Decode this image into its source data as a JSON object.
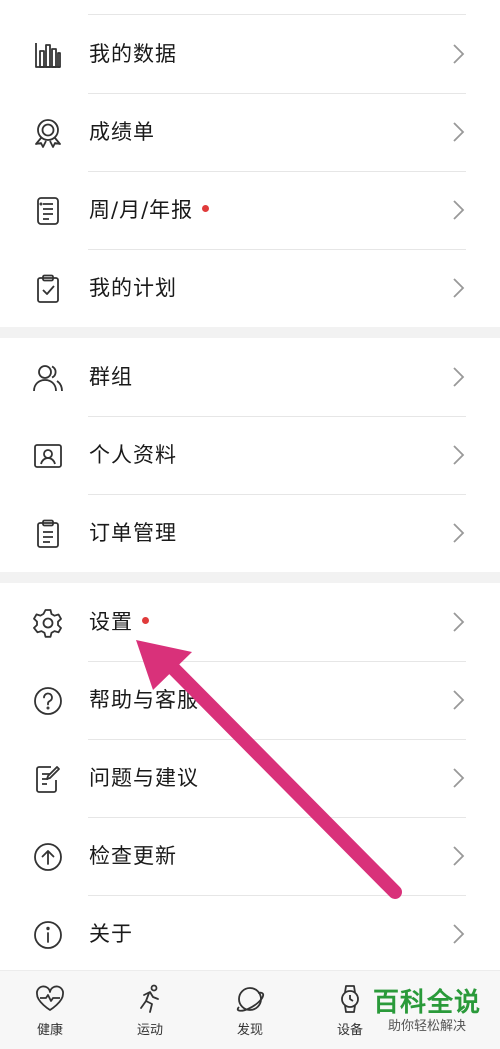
{
  "menu": {
    "section1": [
      {
        "id": "my-data",
        "label": "我的数据",
        "icon": "bar-chart-icon",
        "dot": false
      },
      {
        "id": "report-card",
        "label": "成绩单",
        "icon": "medal-icon",
        "dot": false
      },
      {
        "id": "reports",
        "label": "周/月/年报",
        "icon": "document-list-icon",
        "dot": true
      },
      {
        "id": "my-plan",
        "label": "我的计划",
        "icon": "clipboard-check-icon",
        "dot": false
      }
    ],
    "section2": [
      {
        "id": "groups",
        "label": "群组",
        "icon": "people-icon",
        "dot": false
      },
      {
        "id": "profile",
        "label": "个人资料",
        "icon": "id-card-icon",
        "dot": false
      },
      {
        "id": "orders",
        "label": "订单管理",
        "icon": "clipboard-list-icon",
        "dot": false
      }
    ],
    "section3": [
      {
        "id": "settings",
        "label": "设置",
        "icon": "gear-icon",
        "dot": true
      },
      {
        "id": "help",
        "label": "帮助与客服",
        "icon": "help-circle-icon",
        "dot": false
      },
      {
        "id": "feedback",
        "label": "问题与建议",
        "icon": "edit-note-icon",
        "dot": false
      },
      {
        "id": "update",
        "label": "检查更新",
        "icon": "upload-circle-icon",
        "dot": false
      },
      {
        "id": "about",
        "label": "关于",
        "icon": "info-circle-icon",
        "dot": false
      }
    ]
  },
  "tabbar": [
    {
      "id": "health",
      "label": "健康",
      "icon": "heart-pulse-icon"
    },
    {
      "id": "sport",
      "label": "运动",
      "icon": "running-icon"
    },
    {
      "id": "discover",
      "label": "发现",
      "icon": "planet-icon"
    },
    {
      "id": "device",
      "label": "设备",
      "icon": "watch-icon"
    }
  ],
  "watermark": {
    "title": "百科全说",
    "subtitle": "助你轻松解决"
  },
  "colors": {
    "badge": "#e03b3b",
    "arrow": "#d9317a",
    "watermark": "#2a9a3a",
    "divider": "#e6e6e6",
    "section_gap": "#f2f2f2"
  }
}
